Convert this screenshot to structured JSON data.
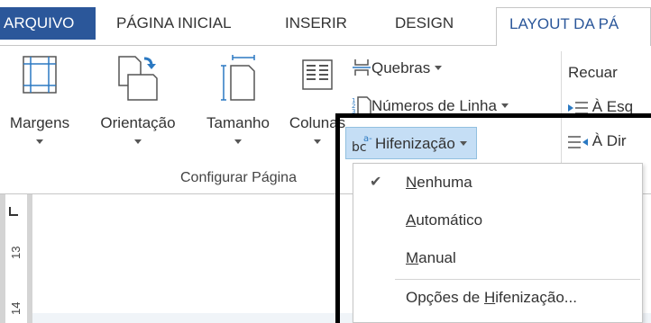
{
  "tabs": {
    "arquivo": "ARQUIVO",
    "pagina_inicial": "PÁGINA INICIAL",
    "inserir": "INSERIR",
    "design": "DESIGN",
    "layout": "LAYOUT DA PÁ"
  },
  "ribbon": {
    "margens": "Margens",
    "orientacao": "Orientação",
    "tamanho": "Tamanho",
    "colunas": "Colunas",
    "quebras": "Quebras",
    "numeros_linha": "Números de Linha",
    "hifenizacao": "Hifenização",
    "group_label": "Configurar Página",
    "recuar": "Recuar",
    "indent_left": "À Esq",
    "indent_right": "À Dir"
  },
  "ruler": {
    "n13": "13",
    "n14": "14"
  },
  "menu": {
    "nenhuma_pre": "",
    "nenhuma_key": "N",
    "nenhuma_post": "enhuma",
    "automatico_key": "A",
    "automatico_post": "utomático",
    "manual_key": "M",
    "manual_post": "anual",
    "opcoes_pre": "Opções de ",
    "opcoes_key": "H",
    "opcoes_post": "ifenização...",
    "checked": "✔"
  },
  "colors": {
    "accent": "#2b579a",
    "highlight": "#c5def5"
  }
}
